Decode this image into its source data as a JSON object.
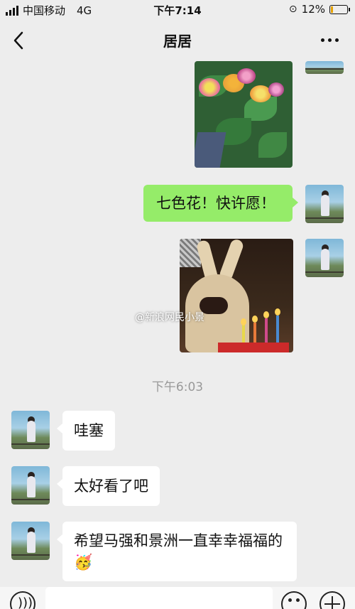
{
  "status_bar": {
    "carrier": "中国移动",
    "network": "4G",
    "time": "下午7:14",
    "battery_percent_text": "12%",
    "battery_level": 0.12
  },
  "header": {
    "title": "居居",
    "back_icon": "chevron-left-icon",
    "more_icon": "more-dots-icon"
  },
  "messages": {
    "outgoing_text": "七色花！快许愿！",
    "watermark": "@新浪网民小景",
    "timestamp": "下午6:03",
    "incoming": [
      {
        "text": "哇塞"
      },
      {
        "text": "太好看了吧"
      },
      {
        "text": "希望马强和景洲一直幸幸福福的🥳"
      }
    ]
  },
  "input_bar": {
    "voice_icon": "voice-icon",
    "emoji_icon": "emoji-icon",
    "plus_icon": "plus-icon"
  },
  "colors": {
    "background": "#ededed",
    "outgoing_bubble": "#95ec69",
    "incoming_bubble": "#ffffff"
  }
}
